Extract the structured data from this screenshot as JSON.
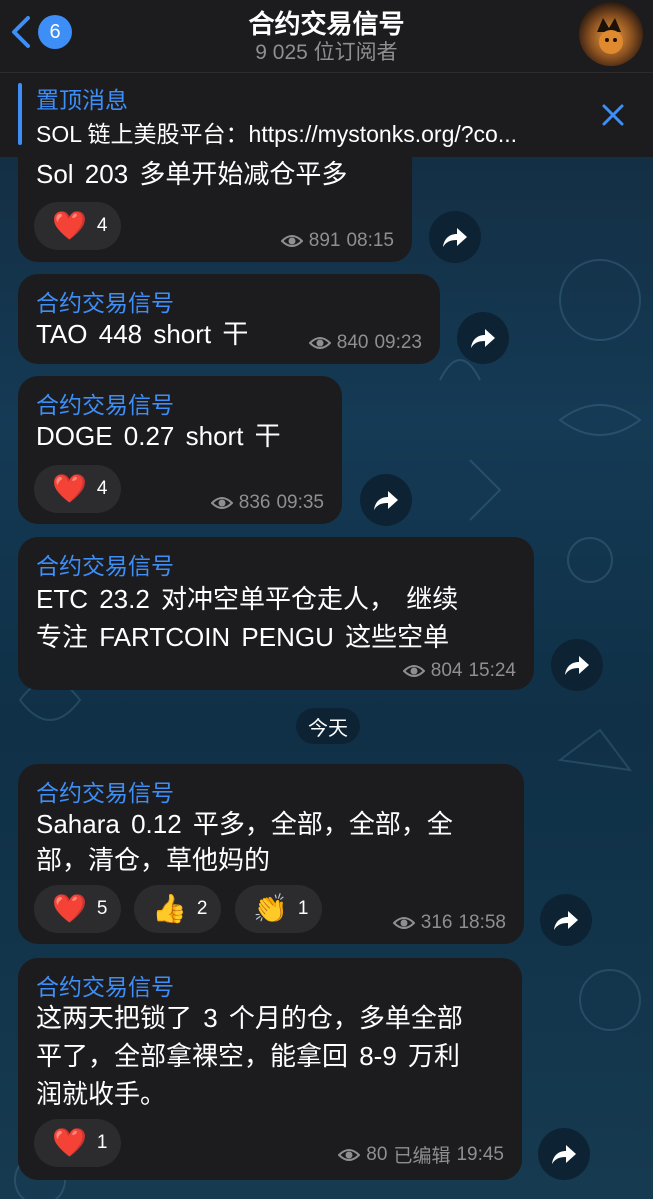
{
  "header": {
    "back_count": "6",
    "title": "合约交易信号",
    "subtitle": "9 025 位订阅者"
  },
  "pinned": {
    "title": "置顶消息",
    "text": "SOL 链上美股平台：https://mystonks.org/?co..."
  },
  "date_separator": "今天",
  "messages": [
    {
      "sender": "",
      "text": "Sol  203  多单开始减仓平多",
      "reactions": [
        {
          "emoji": "❤️",
          "count": "4"
        }
      ],
      "views": "891",
      "time": "08:15"
    },
    {
      "sender": "合约交易信号",
      "text": "TAO  448  short  干",
      "reactions": [],
      "views": "840",
      "time": "09:23"
    },
    {
      "sender": "合约交易信号",
      "text": "DOGE  0.27  short   干",
      "reactions": [
        {
          "emoji": "❤️",
          "count": "4"
        }
      ],
      "views": "836",
      "time": "09:35"
    },
    {
      "sender": "合约交易信号",
      "text_line1": "ETC  23.2  对冲空单平仓走人，  继续",
      "text_line2": "专注 FARTCOIN  PENGU  这些空单",
      "reactions": [],
      "views": "804",
      "time": "15:24"
    },
    {
      "sender": "合约交易信号",
      "text_line1": "Sahara  0.12  平多，全部，全部，全",
      "text_line2": "部，清仓，草他妈的",
      "reactions": [
        {
          "emoji": "❤️",
          "count": "5"
        },
        {
          "emoji": "👍",
          "count": "2"
        },
        {
          "emoji": "👏",
          "count": "1"
        }
      ],
      "views": "316",
      "time": "18:58"
    },
    {
      "sender": "合约交易信号",
      "text_line1": "这两天把锁了 3 个月的仓，多单全部",
      "text_line2": "平了，全部拿裸空，能拿回 8-9 万利",
      "text_line3": "润就收手。",
      "reactions": [
        {
          "emoji": "❤️",
          "count": "1"
        }
      ],
      "views": "80",
      "edited": "已编辑",
      "time": "19:45"
    }
  ],
  "colors": {
    "accent": "#3e8ef7",
    "bubble": "#1c1c1e",
    "meta": "#8e8e93",
    "heart": "#e0262f"
  },
  "icons": {
    "back": "chevron-left-icon",
    "close": "close-icon",
    "views": "eye-icon",
    "share": "share-arrow-icon"
  }
}
